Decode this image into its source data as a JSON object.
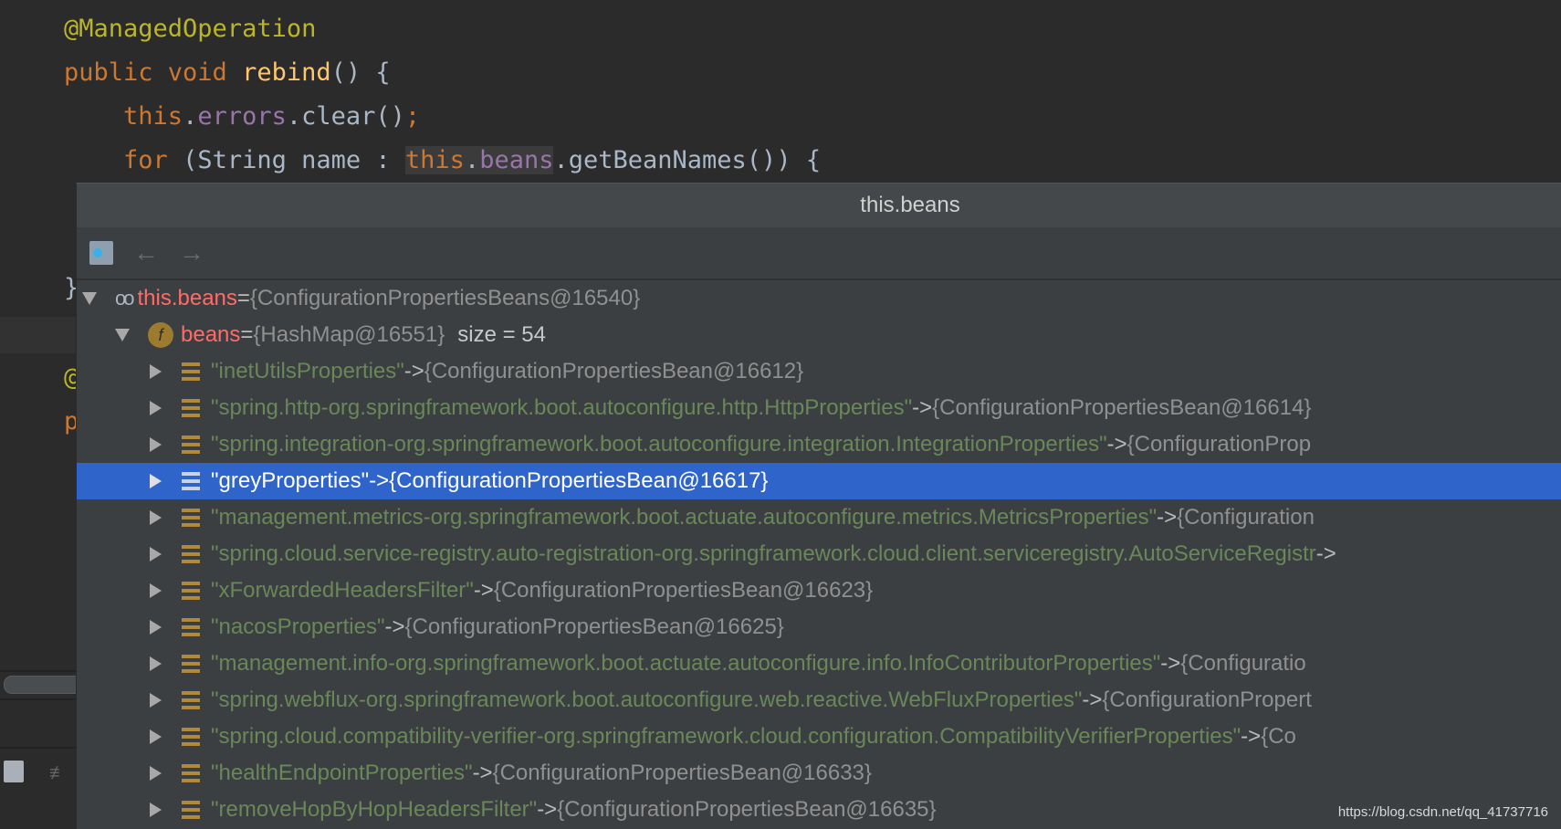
{
  "editor": {
    "lines": [
      {
        "annotation": "@ManagedOperation"
      },
      {
        "kw": "public void ",
        "fn": "rebind",
        "rest": "() {"
      },
      {
        "kw": "this",
        "dot": ".",
        "field": "errors",
        "rest": ".clear()",
        "semi": ";"
      },
      {
        "kw": "for ",
        "mid": "(String name : ",
        "kw2": "this",
        "dot": ".",
        "field": "beans",
        "rest": ".getBeanNames()) {"
      }
    ],
    "brace": "}",
    "frag_at": "@",
    "frag_p": "p"
  },
  "popup": {
    "title": "this.beans",
    "toolbar": {
      "icon": "watch-folder-icon",
      "back": "←",
      "forward": "→"
    },
    "root": {
      "name": "this.beans",
      "eq": " = ",
      "value": "{ConfigurationPropertiesBeans@16540}"
    },
    "field": {
      "icon_letter": "f",
      "name": "beans",
      "eq": " = ",
      "value": "{HashMap@16551}",
      "size": "size = 54"
    },
    "entries": [
      {
        "key": "\"inetUtilsProperties\"",
        "value": "{ConfigurationPropertiesBean@16612}"
      },
      {
        "key": "\"spring.http-org.springframework.boot.autoconfigure.http.HttpProperties\"",
        "value": "{ConfigurationPropertiesBean@16614}"
      },
      {
        "key": "\"spring.integration-org.springframework.boot.autoconfigure.integration.IntegrationProperties\"",
        "value": "{ConfigurationProp"
      },
      {
        "key": "\"greyProperties\"",
        "value": "{ConfigurationPropertiesBean@16617}",
        "selected": true
      },
      {
        "key": "\"management.metrics-org.springframework.boot.actuate.autoconfigure.metrics.MetricsProperties\"",
        "value": "{Configuration"
      },
      {
        "key": "\"spring.cloud.service-registry.auto-registration-org.springframework.cloud.client.serviceregistry.AutoServiceRegistr",
        "value": ""
      },
      {
        "key": "\"xForwardedHeadersFilter\"",
        "value": "{ConfigurationPropertiesBean@16623}"
      },
      {
        "key": "\"nacosProperties\"",
        "value": "{ConfigurationPropertiesBean@16625}"
      },
      {
        "key": "\"management.info-org.springframework.boot.actuate.autoconfigure.info.InfoContributorProperties\"",
        "value": "{Configuratio"
      },
      {
        "key": "\"spring.webflux-org.springframework.boot.autoconfigure.web.reactive.WebFluxProperties\"",
        "value": "{ConfigurationPropert"
      },
      {
        "key": "\"spring.cloud.compatibility-verifier-org.springframework.cloud.configuration.CompatibilityVerifierProperties\"",
        "value": "{Co"
      },
      {
        "key": "\"healthEndpointProperties\"",
        "value": "{ConfigurationPropertiesBean@16633}"
      },
      {
        "key": "\"removeHopByHopHeadersFilter\"",
        "value": "{ConfigurationPropertiesBean@16635}"
      }
    ],
    "arrow": " -> "
  },
  "watermark": "https://blog.csdn.net/qq_41737716",
  "colors": {
    "selection": "#2f65ca",
    "key": "#6a8759",
    "name": "#ff6b68",
    "popup_bg": "#3c3f41"
  }
}
